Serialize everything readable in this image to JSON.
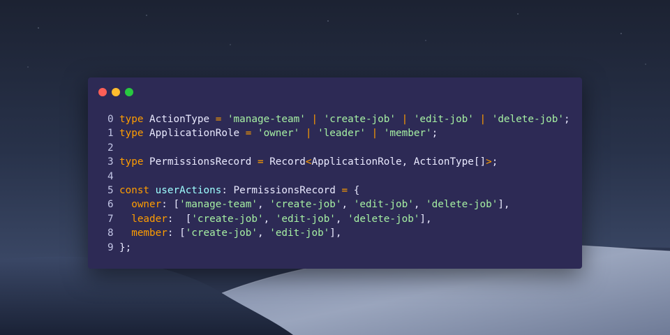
{
  "colors": {
    "window_background": "#2d2a55",
    "keyword": "#ff9d00",
    "string": "#a6f0a3",
    "operator": "#ff9d00",
    "variable": "#9effff",
    "plain_text": "#eaeaff",
    "line_number": "#c3c6e6",
    "traffic_close": "#fe5f57",
    "traffic_minimize": "#febc2e",
    "traffic_maximize": "#28c840"
  },
  "code": {
    "lines": [
      {
        "number": "0",
        "tokens": [
          {
            "t": "keyword",
            "v": "type"
          },
          {
            "t": "text",
            "v": " ActionType "
          },
          {
            "t": "op",
            "v": "="
          },
          {
            "t": "text",
            "v": " "
          },
          {
            "t": "string",
            "v": "'manage-team'"
          },
          {
            "t": "text",
            "v": " "
          },
          {
            "t": "op",
            "v": "|"
          },
          {
            "t": "text",
            "v": " "
          },
          {
            "t": "string",
            "v": "'create-job'"
          },
          {
            "t": "text",
            "v": " "
          },
          {
            "t": "op",
            "v": "|"
          },
          {
            "t": "text",
            "v": " "
          },
          {
            "t": "string",
            "v": "'edit-job'"
          },
          {
            "t": "text",
            "v": " "
          },
          {
            "t": "op",
            "v": "|"
          },
          {
            "t": "text",
            "v": " "
          },
          {
            "t": "string",
            "v": "'delete-job'"
          },
          {
            "t": "text",
            "v": ";"
          }
        ]
      },
      {
        "number": "1",
        "tokens": [
          {
            "t": "keyword",
            "v": "type"
          },
          {
            "t": "text",
            "v": " ApplicationRole "
          },
          {
            "t": "op",
            "v": "="
          },
          {
            "t": "text",
            "v": " "
          },
          {
            "t": "string",
            "v": "'owner'"
          },
          {
            "t": "text",
            "v": " "
          },
          {
            "t": "op",
            "v": "|"
          },
          {
            "t": "text",
            "v": " "
          },
          {
            "t": "string",
            "v": "'leader'"
          },
          {
            "t": "text",
            "v": " "
          },
          {
            "t": "op",
            "v": "|"
          },
          {
            "t": "text",
            "v": " "
          },
          {
            "t": "string",
            "v": "'member'"
          },
          {
            "t": "text",
            "v": ";"
          }
        ]
      },
      {
        "number": "2",
        "tokens": []
      },
      {
        "number": "3",
        "tokens": [
          {
            "t": "keyword",
            "v": "type"
          },
          {
            "t": "text",
            "v": " PermissionsRecord "
          },
          {
            "t": "op",
            "v": "="
          },
          {
            "t": "text",
            "v": " Record"
          },
          {
            "t": "op",
            "v": "<"
          },
          {
            "t": "text",
            "v": "ApplicationRole, ActionType[]"
          },
          {
            "t": "op",
            "v": ">"
          },
          {
            "t": "text",
            "v": ";"
          }
        ]
      },
      {
        "number": "4",
        "tokens": []
      },
      {
        "number": "5",
        "tokens": [
          {
            "t": "keyword",
            "v": "const"
          },
          {
            "t": "text",
            "v": " "
          },
          {
            "t": "var",
            "v": "userActions"
          },
          {
            "t": "text",
            "v": ": PermissionsRecord "
          },
          {
            "t": "op",
            "v": "="
          },
          {
            "t": "text",
            "v": " {"
          }
        ]
      },
      {
        "number": "6",
        "tokens": [
          {
            "t": "text",
            "v": "  "
          },
          {
            "t": "keyword",
            "v": "owner"
          },
          {
            "t": "text",
            "v": ": ["
          },
          {
            "t": "string",
            "v": "'manage-team'"
          },
          {
            "t": "text",
            "v": ", "
          },
          {
            "t": "string",
            "v": "'create-job'"
          },
          {
            "t": "text",
            "v": ", "
          },
          {
            "t": "string",
            "v": "'edit-job'"
          },
          {
            "t": "text",
            "v": ", "
          },
          {
            "t": "string",
            "v": "'delete-job'"
          },
          {
            "t": "text",
            "v": "],"
          }
        ]
      },
      {
        "number": "7",
        "tokens": [
          {
            "t": "text",
            "v": "  "
          },
          {
            "t": "keyword",
            "v": "leader"
          },
          {
            "t": "text",
            "v": ":  ["
          },
          {
            "t": "string",
            "v": "'create-job'"
          },
          {
            "t": "text",
            "v": ", "
          },
          {
            "t": "string",
            "v": "'edit-job'"
          },
          {
            "t": "text",
            "v": ", "
          },
          {
            "t": "string",
            "v": "'delete-job'"
          },
          {
            "t": "text",
            "v": "],"
          }
        ]
      },
      {
        "number": "8",
        "tokens": [
          {
            "t": "text",
            "v": "  "
          },
          {
            "t": "keyword",
            "v": "member"
          },
          {
            "t": "text",
            "v": ": ["
          },
          {
            "t": "string",
            "v": "'create-job'"
          },
          {
            "t": "text",
            "v": ", "
          },
          {
            "t": "string",
            "v": "'edit-job'"
          },
          {
            "t": "text",
            "v": "],"
          }
        ]
      },
      {
        "number": "9",
        "tokens": [
          {
            "t": "text",
            "v": "};"
          }
        ]
      }
    ]
  }
}
